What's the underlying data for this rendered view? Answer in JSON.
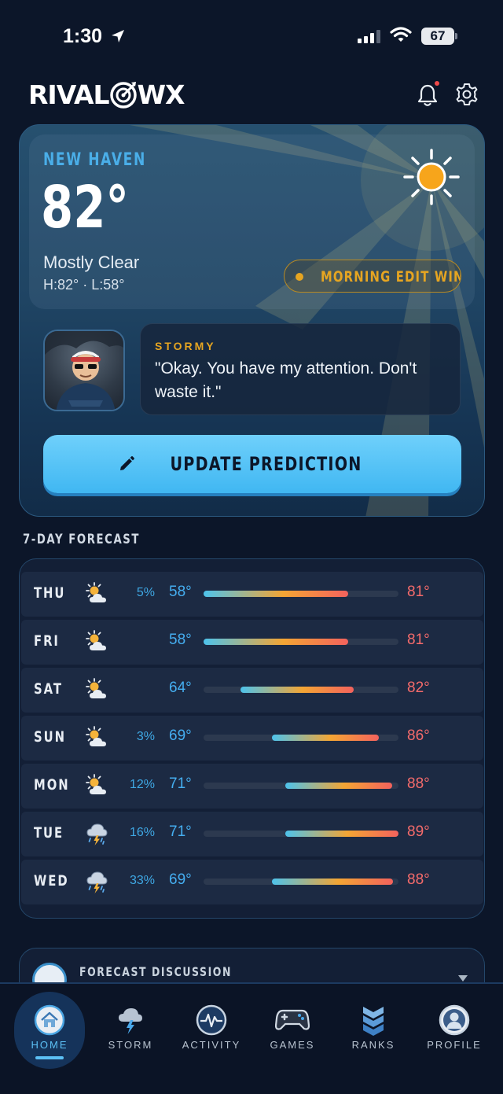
{
  "status_bar": {
    "time": "1:30",
    "battery": "67"
  },
  "header": {
    "logo_left": "RIVAL",
    "logo_right": "WX"
  },
  "hero": {
    "city": "NEW HAVEN",
    "temperature": "82°",
    "condition": "Mostly Clear",
    "hi_lo": "H:82° · L:58°",
    "edit_window_label": "MORNING EDIT WINDOW",
    "speaker": "STORMY",
    "quote": "\"Okay. You have my attention. Don't waste it.\"",
    "update_button": "UPDATE PREDICTION"
  },
  "forecast": {
    "title": "7-DAY FORECAST",
    "days": [
      {
        "day": "THU",
        "icon": "partly-sunny-icon",
        "pop": "5%",
        "lo": "58°",
        "hi": "81°",
        "range_start": 0.0,
        "range_end": 0.74
      },
      {
        "day": "FRI",
        "icon": "partly-sunny-icon",
        "pop": "",
        "lo": "58°",
        "hi": "81°",
        "range_start": 0.0,
        "range_end": 0.74
      },
      {
        "day": "SAT",
        "icon": "partly-sunny-icon",
        "pop": "",
        "lo": "64°",
        "hi": "82°",
        "range_start": 0.19,
        "range_end": 0.77
      },
      {
        "day": "SUN",
        "icon": "partly-sunny-icon",
        "pop": "3%",
        "lo": "69°",
        "hi": "86°",
        "range_start": 0.35,
        "range_end": 0.9
      },
      {
        "day": "MON",
        "icon": "partly-sunny-icon",
        "pop": "12%",
        "lo": "71°",
        "hi": "88°",
        "range_start": 0.42,
        "range_end": 0.97
      },
      {
        "day": "TUE",
        "icon": "thunderstorm-icon",
        "pop": "16%",
        "lo": "71°",
        "hi": "89°",
        "range_start": 0.42,
        "range_end": 1.0
      },
      {
        "day": "WED",
        "icon": "thunderstorm-icon",
        "pop": "33%",
        "lo": "69°",
        "hi": "88°",
        "range_start": 0.35,
        "range_end": 0.97
      }
    ]
  },
  "discussion": {
    "title": "FORECAST DISCUSSION"
  },
  "tabs": [
    {
      "label": "HOME",
      "icon": "home-icon",
      "active": true
    },
    {
      "label": "STORM",
      "icon": "storm-cloud-icon",
      "active": false
    },
    {
      "label": "ACTIVITY",
      "icon": "activity-icon",
      "active": false
    },
    {
      "label": "GAMES",
      "icon": "gamepad-icon",
      "active": false
    },
    {
      "label": "RANKS",
      "icon": "ranks-chevron-icon",
      "active": false
    },
    {
      "label": "PROFILE",
      "icon": "profile-icon",
      "active": false
    }
  ],
  "colors": {
    "accent_blue": "#4aaee8",
    "accent_gold": "#e6a521",
    "hi_temp": "#f56b6b",
    "background": "#0c1629"
  }
}
